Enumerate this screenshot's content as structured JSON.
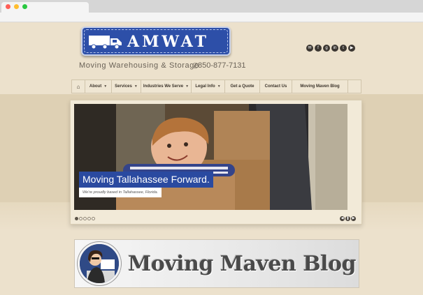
{
  "header": {
    "logo_text": "AMWAT",
    "tagline": "Moving  Warehousing  &  Storage",
    "phone": "850-877-7131"
  },
  "social_icons": [
    "email-icon",
    "facebook-icon",
    "google-plus-icon",
    "linkedin-icon",
    "twitter-icon",
    "youtube-icon"
  ],
  "nav": {
    "home_icon": "home-icon",
    "items": [
      {
        "label": "About",
        "has_dropdown": true
      },
      {
        "label": "Services",
        "has_dropdown": true
      },
      {
        "label": "Industries We Serve",
        "has_dropdown": true
      },
      {
        "label": "Legal Info",
        "has_dropdown": true
      },
      {
        "label": "Get a Quote",
        "has_dropdown": false
      },
      {
        "label": "Contact Us",
        "has_dropdown": false
      },
      {
        "label": "Moving Maven Blog",
        "has_dropdown": false
      }
    ]
  },
  "slider": {
    "caption_title": "Moving Tallahassee Forward.",
    "caption_subtitle": "We're proudly based in Tallahassee, Florida.",
    "slide_count": 5,
    "active_slide": 1
  },
  "blog_banner": {
    "title": "Moving Maven Blog"
  },
  "colors": {
    "brand_blue": "#2d4fa8",
    "page_bg": "#ece1cc",
    "caption_bg": "#2a4aa0",
    "nav_bg": "#efe6d3"
  }
}
